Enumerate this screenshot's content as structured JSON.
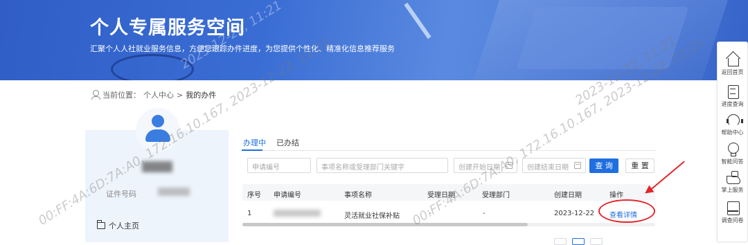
{
  "banner": {
    "title": "个人专属服务空间",
    "subtitle": "汇聚个人人社就业服务信息，方便您跟踪办件进度，为您提供个性化、精准化信息推荐服务"
  },
  "breadcrumb": {
    "prefix": "当前位置：",
    "home": "个人中心",
    "sep": ">",
    "current": "我的办件"
  },
  "profile": {
    "id_label": "证件号码",
    "menu": [
      "个人主页"
    ]
  },
  "tabs": [
    {
      "label": "办理中",
      "active": true
    },
    {
      "label": "已办结",
      "active": false
    }
  ],
  "filters": {
    "apply_no_placeholder": "申请编号",
    "keyword_placeholder": "事项名称或受理部门关键字",
    "start_date_placeholder": "创建开始日期",
    "end_date_placeholder": "创建结束日期",
    "query_label": "查 询",
    "reset_label": "重 置"
  },
  "table": {
    "columns": [
      "序号",
      "申请编号",
      "事项名称",
      "受理日期",
      "受理部门",
      "创建日期",
      "操作"
    ],
    "rows": [
      {
        "index": "1",
        "item_name": "灵活就业社保补贴",
        "accept_date": "-",
        "accept_dept": "-",
        "create_date": "2023-12-22",
        "action": "查看详情"
      }
    ]
  },
  "toolbar": {
    "items": [
      {
        "label": "返回首页",
        "icon": "home-icon"
      },
      {
        "label": "进度查询",
        "icon": "document-icon"
      },
      {
        "label": "帮助中心",
        "icon": "headset-icon"
      },
      {
        "label": "智能问答",
        "icon": "bulb-icon"
      },
      {
        "label": "掌上服务",
        "icon": "hand-icon"
      },
      {
        "label": "调查问卷",
        "icon": "book-icon"
      }
    ]
  },
  "watermark": {
    "text1": "00:FF:4A:6D:7A:A0, 172.16.10.167, 2023-12-22, 11:21",
    "text2": "2023-12-22, 11:21"
  },
  "colors": {
    "accent": "#1f6fe0",
    "annotation": "#e3262b",
    "banner": "#3a6dd4"
  }
}
